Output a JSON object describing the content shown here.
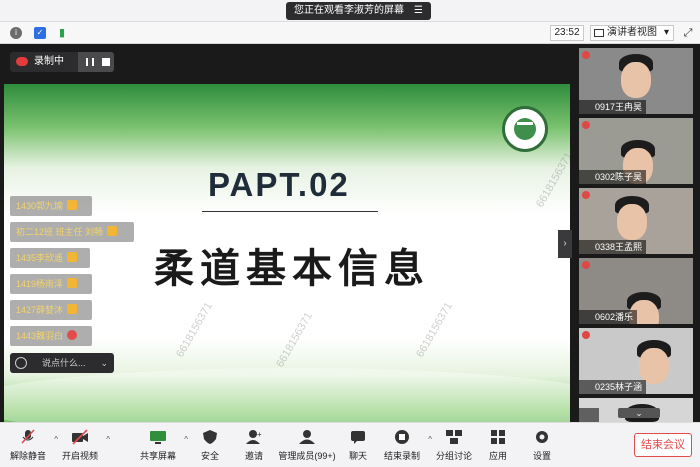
{
  "top_banner": {
    "text": "您正在观看李淑芳的屏幕",
    "menu_icon": "menu-icon"
  },
  "status_bar": {
    "time": "23:52",
    "view_mode": "演讲者视图",
    "view_caret": "▾",
    "fullscreen": "⤢"
  },
  "recording": {
    "label": "录制中"
  },
  "slide": {
    "heading": "PAPT.02",
    "subheading": "柔道基本信息",
    "watermarks": [
      "6618156371",
      "6618156371",
      "6618156371",
      "6618156371"
    ]
  },
  "chat_messages": [
    {
      "text": "1430郭九瑜"
    },
    {
      "text": "初二12班 班主任 刘畅"
    },
    {
      "text": "1435李欣遥"
    },
    {
      "text": "1419杨雨泽"
    },
    {
      "text": "1427薛婪沐"
    },
    {
      "text": "1443魏羽白"
    }
  ],
  "chat_input": {
    "placeholder": "说点什么...",
    "collapse": "⌄"
  },
  "participants": [
    {
      "name": "0917王冉昊"
    },
    {
      "name": "0302陈子昊"
    },
    {
      "name": "0338王孟熙"
    },
    {
      "name": "0602潘乐"
    },
    {
      "name": "0235林子涵"
    },
    {
      "name": ""
    }
  ],
  "toolbar": {
    "unmute": "解除静音",
    "start_video": "开启视频",
    "share_screen": "共享屏幕",
    "security": "安全",
    "invite": "邀请",
    "members": "管理成员(99+)",
    "chat": "聊天",
    "end_record": "结束录制",
    "breakout": "分组讨论",
    "apps": "应用",
    "settings": "设置",
    "end_meeting": "结束会议"
  },
  "colors": {
    "record_red": "#e43c3c",
    "end_red": "#e24c4c",
    "slide_green": "#2f9c32"
  }
}
